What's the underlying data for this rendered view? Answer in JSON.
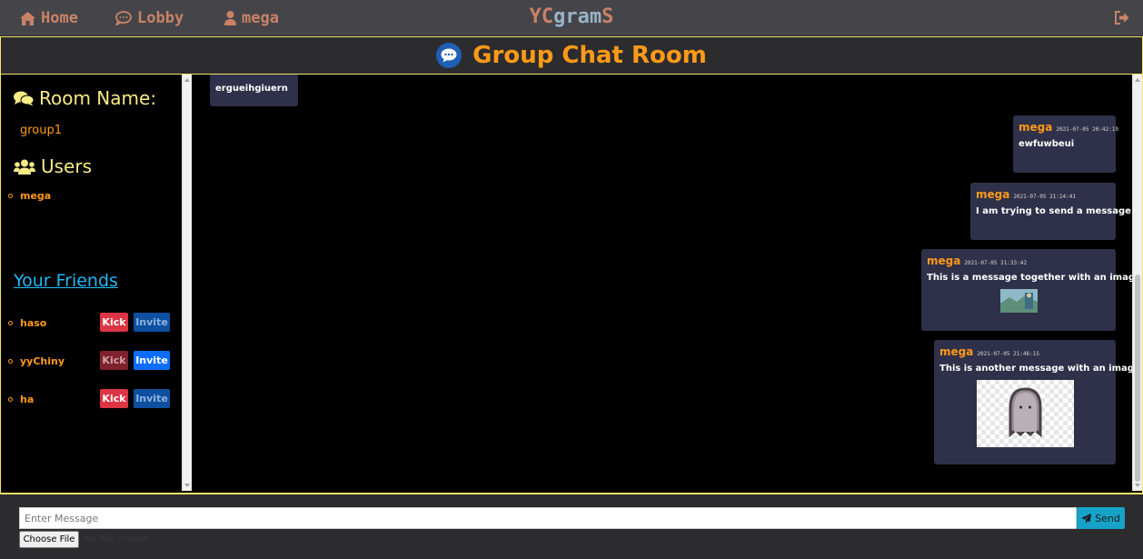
{
  "navbar": {
    "home_label": "Home",
    "lobby_label": "Lobby",
    "user_label": "mega",
    "brand_part1": "YC",
    "brand_part2": "gram",
    "brand_part3": "S"
  },
  "title": "Group Chat Room",
  "sidebar": {
    "room_heading": "Room Name:",
    "room_name": "group1",
    "users_heading": "Users",
    "users": [
      "mega"
    ],
    "friends_heading": "Your Friends",
    "friends": [
      {
        "name": "haso",
        "kick_label": "Kick",
        "invite_label": "Invite",
        "kick_disabled": false,
        "invite_active": false
      },
      {
        "name": "yyChiny",
        "kick_label": "Kick",
        "invite_label": "Invite",
        "kick_disabled": true,
        "invite_active": true
      },
      {
        "name": "ha",
        "kick_label": "Kick",
        "invite_label": "Invite",
        "kick_disabled": false,
        "invite_active": false
      }
    ]
  },
  "messages": [
    {
      "text": "ergueihgiuern"
    },
    {
      "user": "mega",
      "time": "2021-07-05 20:42:19",
      "text": "ewfuwbeui"
    },
    {
      "user": "mega",
      "time": "2021-07-05 21:14:41",
      "text": "I am trying to send a message"
    },
    {
      "user": "mega",
      "time": "2021-07-05 21:33:42",
      "text": "This is a message together with an image",
      "image": "landscape-thumbnail"
    },
    {
      "user": "mega",
      "time": "2021-07-05 21:46:15",
      "text": "This is another message with an image",
      "image": "ghost-sticker"
    }
  ],
  "composer": {
    "placeholder": "Enter Message",
    "send_label": "Send",
    "file_button_label": "Choose File",
    "file_status": "No file chosen"
  },
  "colors": {
    "accent_orange": "#ff9a18",
    "nav_link": "#c98267",
    "border_yellow": "#f3e36a",
    "message_bg": "#2f3049",
    "send_button": "#17a2c8",
    "kick_button": "#dc3545",
    "invite_button": "#0d6efd"
  }
}
